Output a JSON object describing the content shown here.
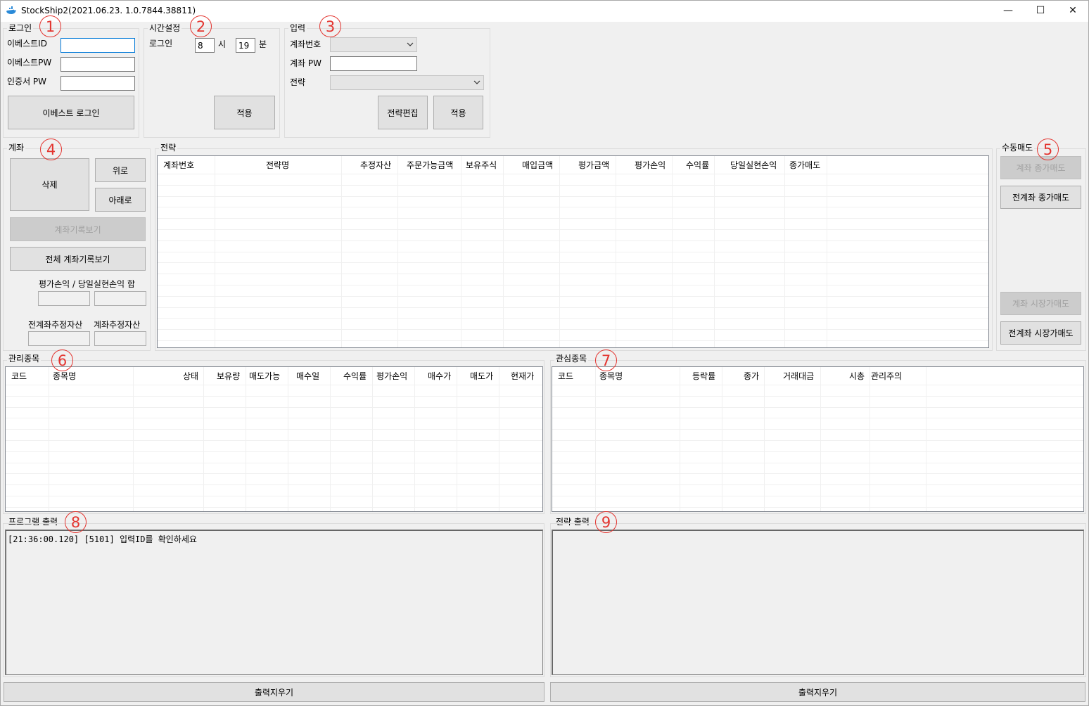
{
  "window": {
    "title": "StockShip2(2021.06.23.  1.0.7844.38811)",
    "minimize": "—",
    "maximize": "☐",
    "close": "✕"
  },
  "login": {
    "group_label": "로그인",
    "id_label": "이베스트ID",
    "id_value": "",
    "pw_label": "이베스트PW",
    "cert_label": "인증서 PW",
    "login_button": "이베스트 로그인"
  },
  "time": {
    "group_label": "시간설정",
    "login_label": "로그인",
    "hour_value": "8",
    "hour_unit": "시",
    "minute_value": "19",
    "minute_unit": "분",
    "apply_button": "적용"
  },
  "input": {
    "group_label": "입력",
    "account_label": "계좌번호",
    "account_pw_label": "계좌 PW",
    "strategy_label": "전략",
    "edit_button": "전략편집",
    "apply_button": "적용"
  },
  "account": {
    "group_label": "계좌",
    "delete_button": "삭제",
    "up_button": "위로",
    "down_button": "아래로",
    "history_button": "계좌기록보기",
    "all_history_button": "전체 계좌기록보기",
    "pnl_label": "평가손익 / 당일실현손익 합",
    "all_est_label": "전계좌추정자산",
    "est_label": "계좌추정자산"
  },
  "strategy": {
    "group_label": "전략",
    "columns": [
      "계좌번호",
      "전략명",
      "추정자산",
      "주문가능금액",
      "보유주식",
      "매입금액",
      "평가금액",
      "평가손익",
      "수익률",
      "당일실현손익",
      "종가매도"
    ]
  },
  "manual_sell": {
    "group_label": "수동매도",
    "account_close_sell": "계좌 종가매도",
    "all_close_sell": "전계좌 종가매도",
    "account_market_sell": "계좌 시장가매도",
    "all_market_sell": "전계좌 시장가매도"
  },
  "managed": {
    "group_label": "관리종목",
    "columns": [
      "코드",
      "종목명",
      "상태",
      "보유량",
      "매도가능",
      "매수일",
      "수익률",
      "평가손익",
      "매수가",
      "매도가",
      "현재가"
    ]
  },
  "watch": {
    "group_label": "관심종목",
    "columns": [
      "코드",
      "종목명",
      "등락률",
      "종가",
      "거래대금",
      "시총",
      "관리주의"
    ]
  },
  "program_output": {
    "group_label": "프로그램 출력",
    "text": "[21:36:00.120] [5101] 입력ID를 확인하세요",
    "clear_button": "출력지우기"
  },
  "strategy_output": {
    "group_label": "전략 출력",
    "text": "",
    "clear_button": "출력지우기"
  },
  "annotations": [
    "1",
    "2",
    "3",
    "4",
    "5",
    "6",
    "7",
    "8",
    "9"
  ],
  "colors": {
    "marker": "#e3342f",
    "focus": "#0078d7"
  }
}
